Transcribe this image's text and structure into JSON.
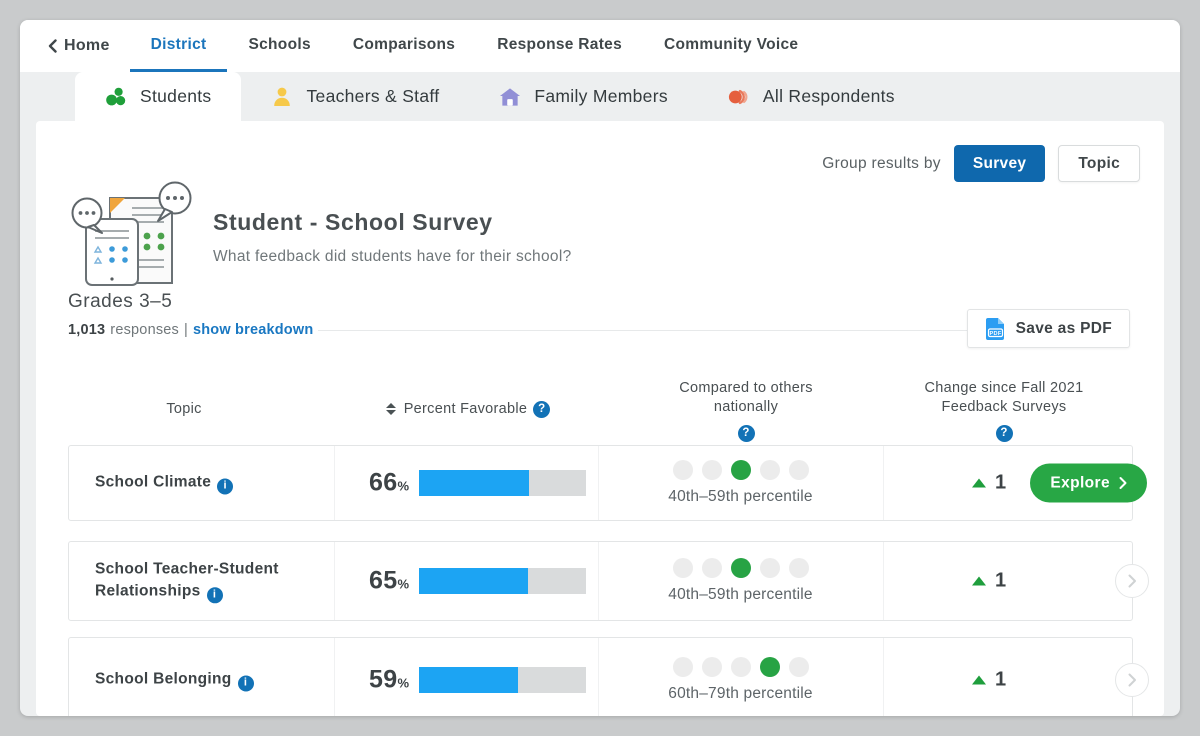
{
  "nav": {
    "home_label": "Home",
    "items": [
      {
        "label": "District",
        "active": true
      },
      {
        "label": "Schools",
        "active": false
      },
      {
        "label": "Comparisons",
        "active": false
      },
      {
        "label": "Response Rates",
        "active": false
      },
      {
        "label": "Community Voice",
        "active": false
      }
    ]
  },
  "audience_tabs": [
    {
      "label": "Students",
      "icon": "students-cluster-icon",
      "active": true
    },
    {
      "label": "Teachers & Staff",
      "icon": "person-icon",
      "active": false
    },
    {
      "label": "Family Members",
      "icon": "house-icon",
      "active": false
    },
    {
      "label": "All Respondents",
      "icon": "overlapping-circles-icon",
      "active": false
    }
  ],
  "toolbar": {
    "group_label": "Group results by",
    "survey_label": "Survey",
    "topic_label": "Topic"
  },
  "survey_header": {
    "title": "Student - School Survey",
    "question": "What feedback did students have for their school?",
    "grades": "Grades 3–5",
    "responses_count": "1,013",
    "responses_label": "responses",
    "separator": "|",
    "breakdown_link": "show breakdown",
    "save_pdf_label": "Save as PDF"
  },
  "table": {
    "headers": {
      "topic": "Topic",
      "percent_favorable": "Percent Favorable",
      "compared_line1": "Compared to others",
      "compared_line2": "nationally",
      "change_line1": "Change since Fall 2021",
      "change_line2": "Feedback Surveys"
    },
    "rows": [
      {
        "topic": "School Climate",
        "percent": 66,
        "percentile": "40th–59th percentile",
        "dot_green_index": 2,
        "change": "1",
        "change_direction": "up",
        "action_label": "Explore"
      },
      {
        "topic": "School Teacher-Student Relationships",
        "percent": 65,
        "percentile": "40th–59th percentile",
        "dot_green_index": 2,
        "change": "1",
        "change_direction": "up"
      },
      {
        "topic": "School Belonging",
        "percent": 59,
        "percentile": "60th–79th percentile",
        "dot_green_index": 3,
        "change": "1",
        "change_direction": "up"
      }
    ]
  },
  "glyphs": {
    "question": "?",
    "info": "i",
    "percent": "%"
  },
  "colors": {
    "accent_blue": "#1272b6",
    "nav_active_blue": "#1b75bc",
    "survey_button_blue": "#0f68ad",
    "bar_blue": "#1ca4f3",
    "bar_track": "#d9dbdc",
    "green": "#27a344",
    "explore_green": "#28a745",
    "link_blue": "#1a78c2",
    "tab_yellow": "#f6c94a",
    "tab_purple": "#918fd6",
    "tab_orange": "#e55f3e"
  }
}
